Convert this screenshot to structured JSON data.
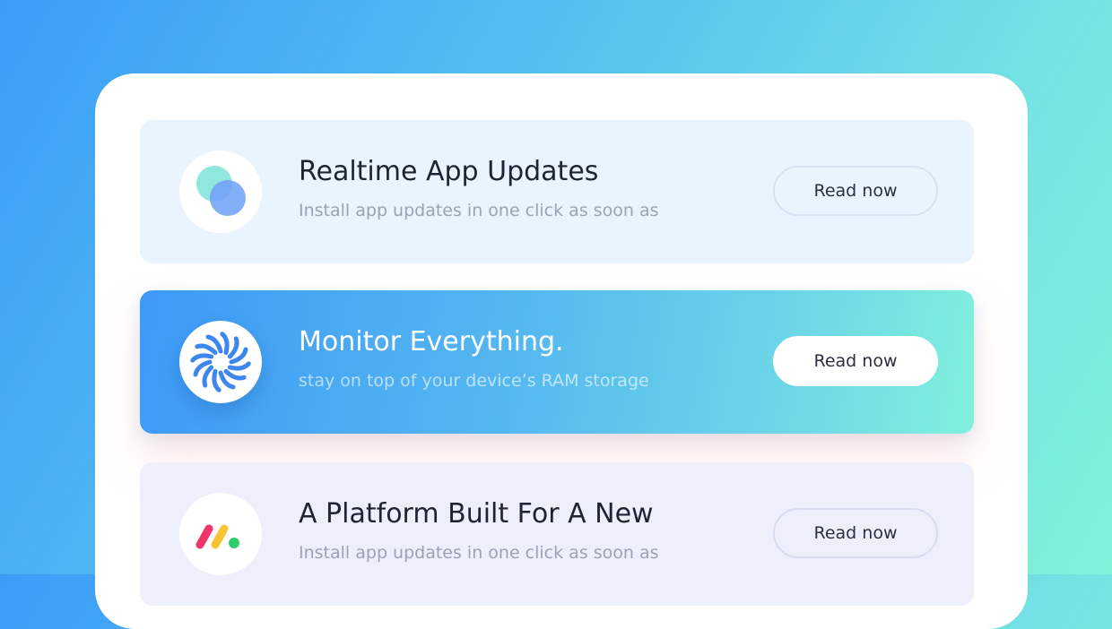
{
  "colors": {
    "page_gradient_start": "#3b9cf8",
    "page_gradient_end": "#7ef3d8",
    "card_highlight_start": "#3d99f6",
    "card_highlight_end": "#80f1dc",
    "title_text": "#1f2433",
    "subtitle_text": "#9aa3b4"
  },
  "cards": [
    {
      "icon": "overlapping-circles-icon",
      "title": "Realtime App Updates",
      "subtitle": "Install app updates in one click as soon as",
      "button_label": "Read now",
      "highlighted": false
    },
    {
      "icon": "swirl-spinner-icon",
      "title": "Monitor Everything.",
      "subtitle": "stay on top of your device’s RAM storage",
      "button_label": "Read now",
      "highlighted": true
    },
    {
      "icon": "monday-logo-icon",
      "title": "A Platform Built For A New",
      "subtitle": "Install app updates in one click as soon as",
      "button_label": "Read now",
      "highlighted": false
    }
  ]
}
